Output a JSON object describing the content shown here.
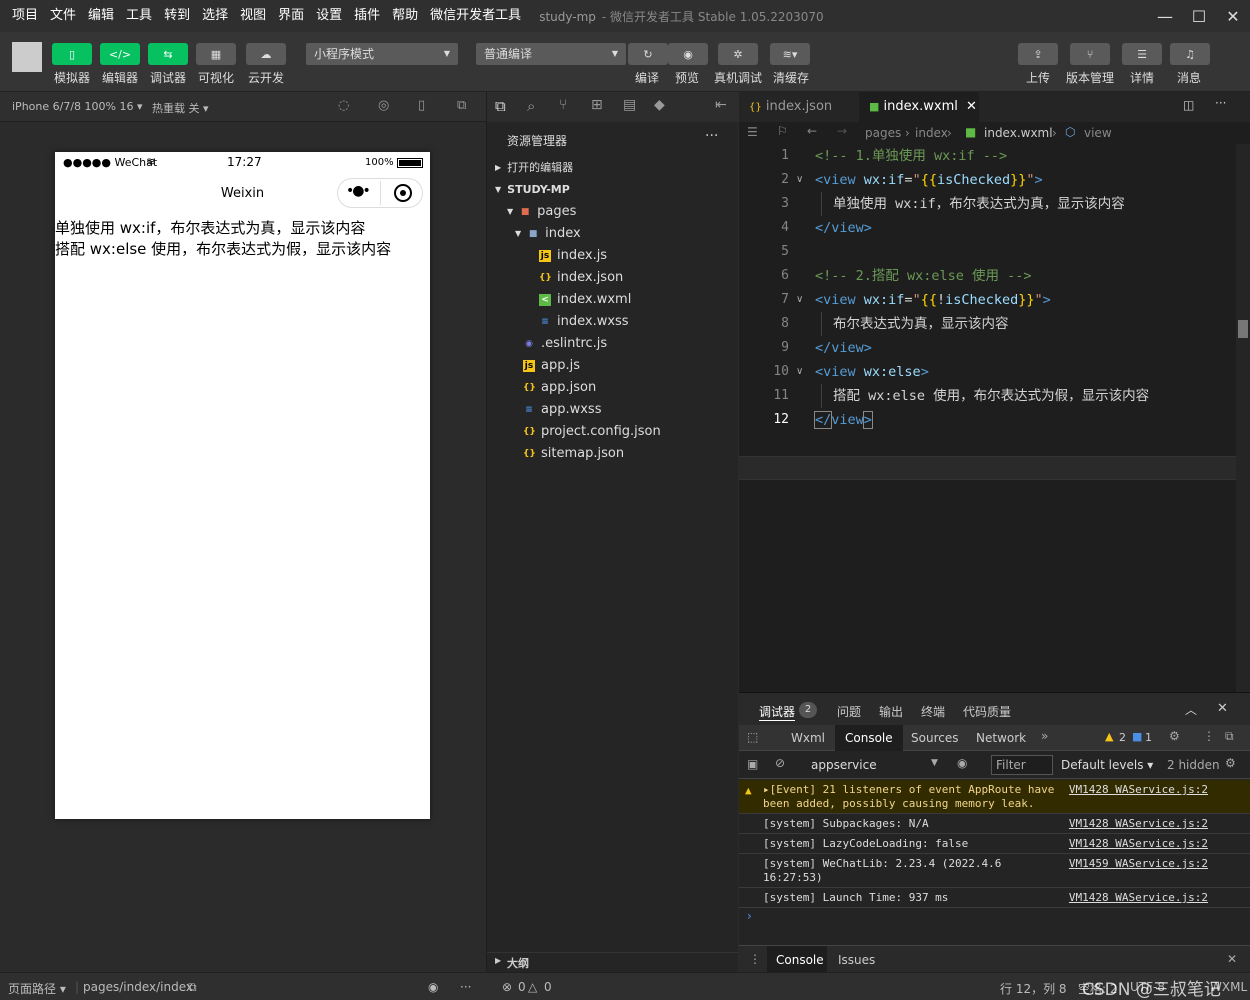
{
  "menubar": {
    "items": [
      "项目",
      "文件",
      "编辑",
      "工具",
      "转到",
      "选择",
      "视图",
      "界面",
      "设置",
      "插件",
      "帮助",
      "微信开发者工具"
    ],
    "project": "study-mp",
    "app_title": "- 微信开发者工具 Stable 1.05.2203070"
  },
  "toolbar": {
    "left_buttons": [
      "模拟器",
      "编辑器",
      "调试器",
      "可视化",
      "云开发"
    ],
    "mode_select": "小程序模式",
    "compile_select": "普通编译",
    "mid_buttons": [
      "编译",
      "预览",
      "真机调试",
      "清缓存"
    ],
    "right_buttons": [
      "上传",
      "版本管理",
      "详情",
      "消息"
    ]
  },
  "simulator": {
    "device": "iPhone 6/7/8 100% 16 ▾",
    "hot_reload": "热重载 关 ▾",
    "status_carrier": "●●●●● WeChat",
    "status_time": "17:27",
    "status_battery": "100%",
    "nav_title": "Weixin",
    "lines": [
      "单独使用 wx:if，布尔表达式为真，显示该内容",
      "搭配 wx:else 使用，布尔表达式为假，显示该内容"
    ]
  },
  "explorer": {
    "title": "资源管理器",
    "open_editors": "打开的编辑器",
    "project": "STUDY-MP",
    "outline": "大纲",
    "errors": "0",
    "warnings": "0",
    "tree": [
      {
        "name": "pages",
        "icon": "folder"
      },
      {
        "name": "index",
        "icon": "folder"
      },
      {
        "name": "index.js",
        "icon": "js"
      },
      {
        "name": "index.json",
        "icon": "json"
      },
      {
        "name": "index.wxml",
        "icon": "wxml"
      },
      {
        "name": "index.wxss",
        "icon": "wxss"
      },
      {
        "name": ".eslintrc.js",
        "icon": "eslint"
      },
      {
        "name": "app.js",
        "icon": "js"
      },
      {
        "name": "app.json",
        "icon": "json"
      },
      {
        "name": "app.wxss",
        "icon": "wxss"
      },
      {
        "name": "project.config.json",
        "icon": "json"
      },
      {
        "name": "sitemap.json",
        "icon": "json"
      }
    ]
  },
  "editor": {
    "tabs": [
      "index.json",
      "index.wxml"
    ],
    "active_tab": "index.wxml",
    "breadcrumb": [
      "pages",
      "index",
      "index.wxml",
      "view"
    ],
    "line_numbers": [
      "1",
      "2",
      "3",
      "4",
      "5",
      "6",
      "7",
      "8",
      "9",
      "10",
      "11",
      "12"
    ],
    "code": {
      "l1": "<!-- 1.单独使用 wx:if -->",
      "l3": "单独使用 wx:if，布尔表达式为真，显示该内容",
      "l6": "<!-- 2.搭配 wx:else 使用 -->",
      "l8": "布尔表达式为真，显示该内容",
      "l11": "搭配 wx:else 使用，布尔表达式为假，显示该内容"
    }
  },
  "devtools": {
    "top_tabs": [
      "调试器",
      "问题",
      "输出",
      "终端",
      "代码质量"
    ],
    "debugger_badge": "2",
    "sub_tabs": [
      "Wxml",
      "Console",
      "Sources",
      "Network"
    ],
    "active_sub": "Console",
    "warn_count": "2",
    "info_count": "1",
    "context": "appservice",
    "filter_placeholder": "Filter",
    "levels": "Default levels ▾",
    "hidden": "2 hidden",
    "logs": [
      {
        "msg": "▸[Event] 21 listeners of event AppRoute have been added, possibly causing memory leak.",
        "src": "VM1428 WAService.js:2",
        "warn": true
      },
      {
        "msg": "[system] Subpackages: N/A",
        "src": "VM1428 WAService.js:2"
      },
      {
        "msg": "[system] LazyCodeLoading: false",
        "src": "VM1428 WAService.js:2"
      },
      {
        "msg": "[system] WeChatLib: 2.23.4 (2022.4.6 16:27:53)",
        "src": "VM1459 WAService.js:2"
      },
      {
        "msg": "[system] Launch Time: 937 ms",
        "src": "VM1428 WAService.js:2"
      }
    ],
    "bottom_tabs": [
      "Console",
      "Issues"
    ]
  },
  "statusbar": {
    "page_path_label": "页面路径 ▾",
    "page_path": "pages/index/index",
    "cursor": "行 12，列 8",
    "spaces": "空格: 2",
    "encoding": "UTF-8",
    "lang": "WXML",
    "watermark": "CSDN @三叔笔记"
  }
}
